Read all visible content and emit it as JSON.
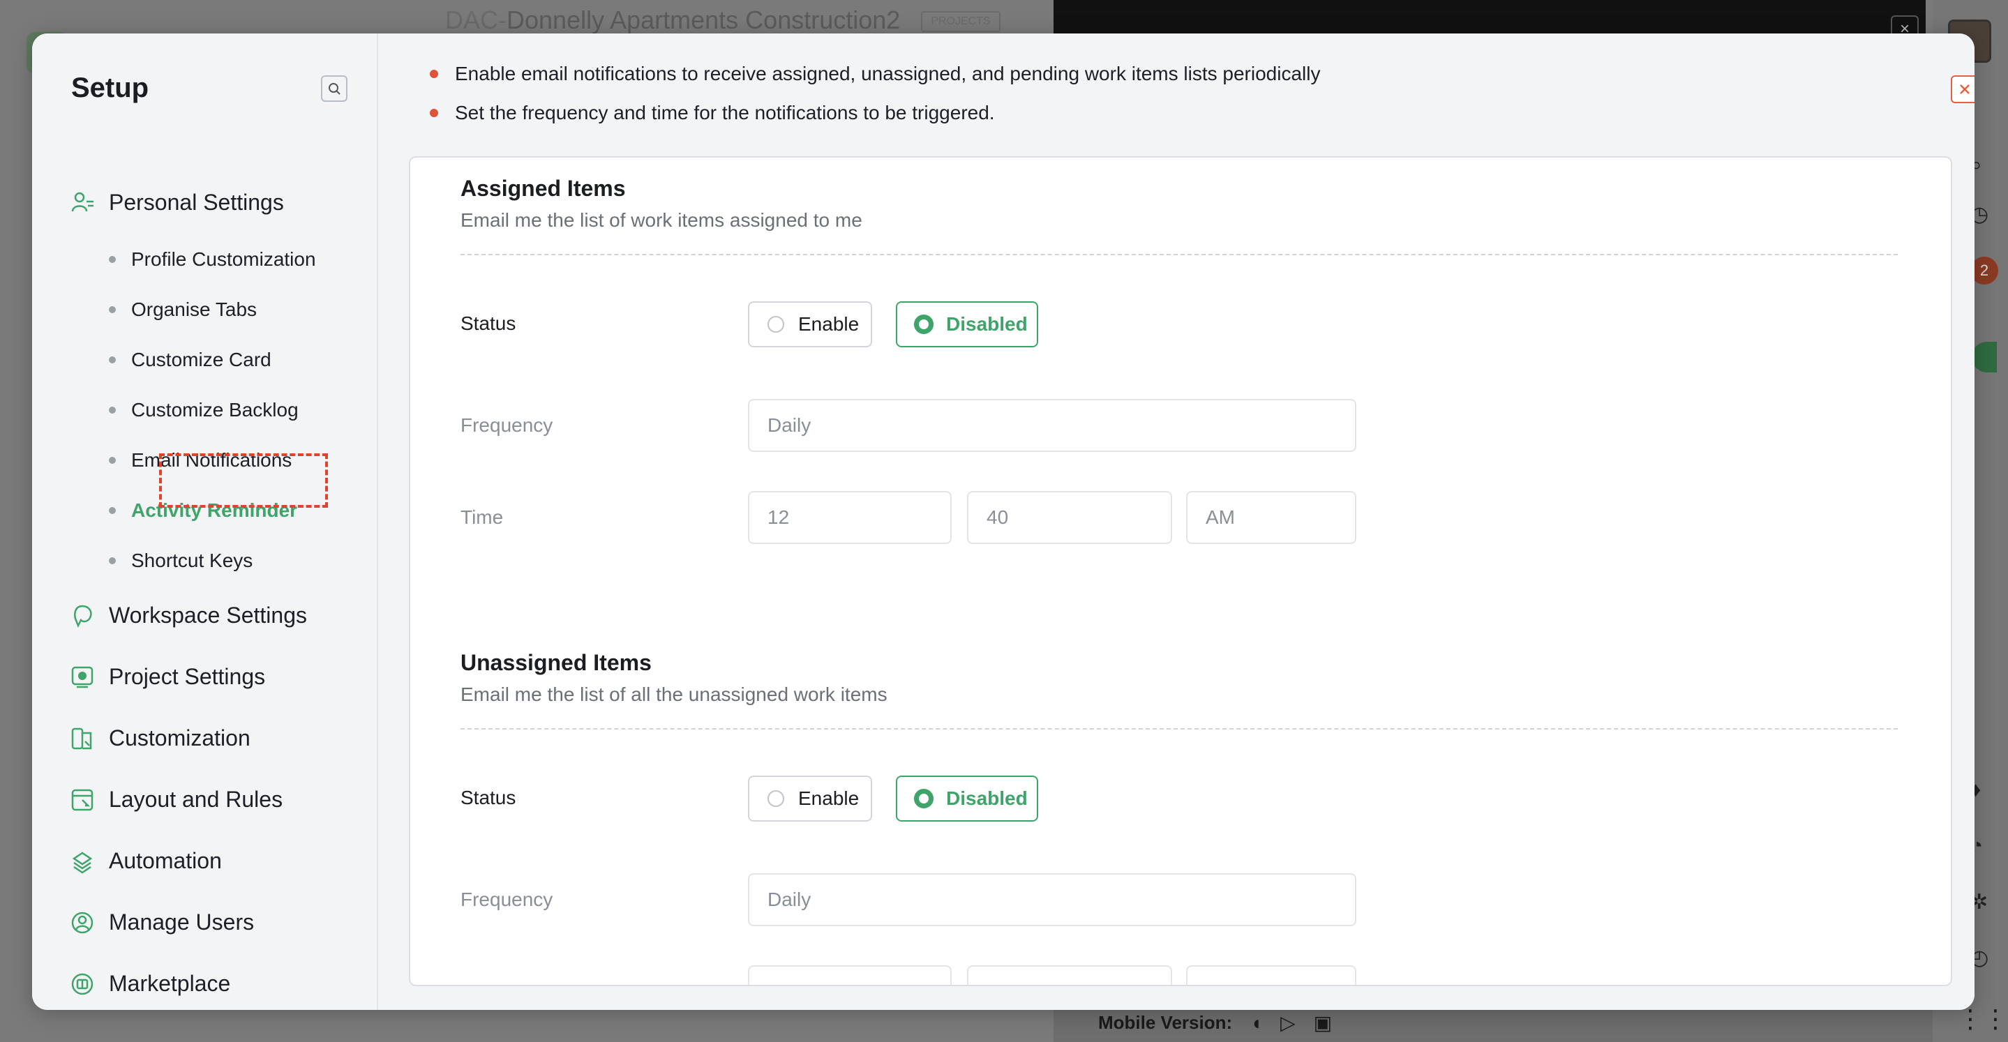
{
  "background": {
    "project_prefix": "DAC-",
    "project_name": "Donnelly Apartments Construction2",
    "project_badge": "PROJECTS",
    "mobile_label": "Mobile Version:",
    "notification_count": "2"
  },
  "sidebar": {
    "title": "Setup",
    "sections": [
      {
        "label": "Personal Settings",
        "icon": "person-settings-icon"
      },
      {
        "label": "Workspace Settings",
        "icon": "workspace-icon"
      },
      {
        "label": "Project Settings",
        "icon": "project-icon"
      },
      {
        "label": "Customization",
        "icon": "customization-icon"
      },
      {
        "label": "Layout and Rules",
        "icon": "layout-icon"
      },
      {
        "label": "Automation",
        "icon": "automation-icon"
      },
      {
        "label": "Manage Users",
        "icon": "users-icon"
      },
      {
        "label": "Marketplace",
        "icon": "marketplace-icon"
      }
    ],
    "personal_items": [
      {
        "label": "Profile Customization"
      },
      {
        "label": "Organise Tabs"
      },
      {
        "label": "Customize Card"
      },
      {
        "label": "Customize Backlog"
      },
      {
        "label": "Email Notifications"
      },
      {
        "label": "Activity Reminder",
        "active": true
      },
      {
        "label": "Shortcut Keys"
      }
    ]
  },
  "notices": [
    "Enable email notifications to receive assigned, unassigned, and pending work items lists periodically",
    "Set the frequency and time for the notifications to be triggered."
  ],
  "assigned": {
    "title": "Assigned Items",
    "description": "Email me the list of work items assigned to me",
    "status_label": "Status",
    "enable_label": "Enable",
    "disabled_label": "Disabled",
    "frequency_label": "Frequency",
    "frequency_value": "Daily",
    "time_label": "Time",
    "hour": "12",
    "minute": "40",
    "meridiem": "AM"
  },
  "unassigned": {
    "title": "Unassigned Items",
    "description": "Email me the list of all the unassigned work items",
    "status_label": "Status",
    "enable_label": "Enable",
    "disabled_label": "Disabled",
    "frequency_label": "Frequency",
    "frequency_value": "Daily"
  },
  "colors": {
    "accent_green": "#3fa46a",
    "alert_orange": "#e0523a"
  }
}
